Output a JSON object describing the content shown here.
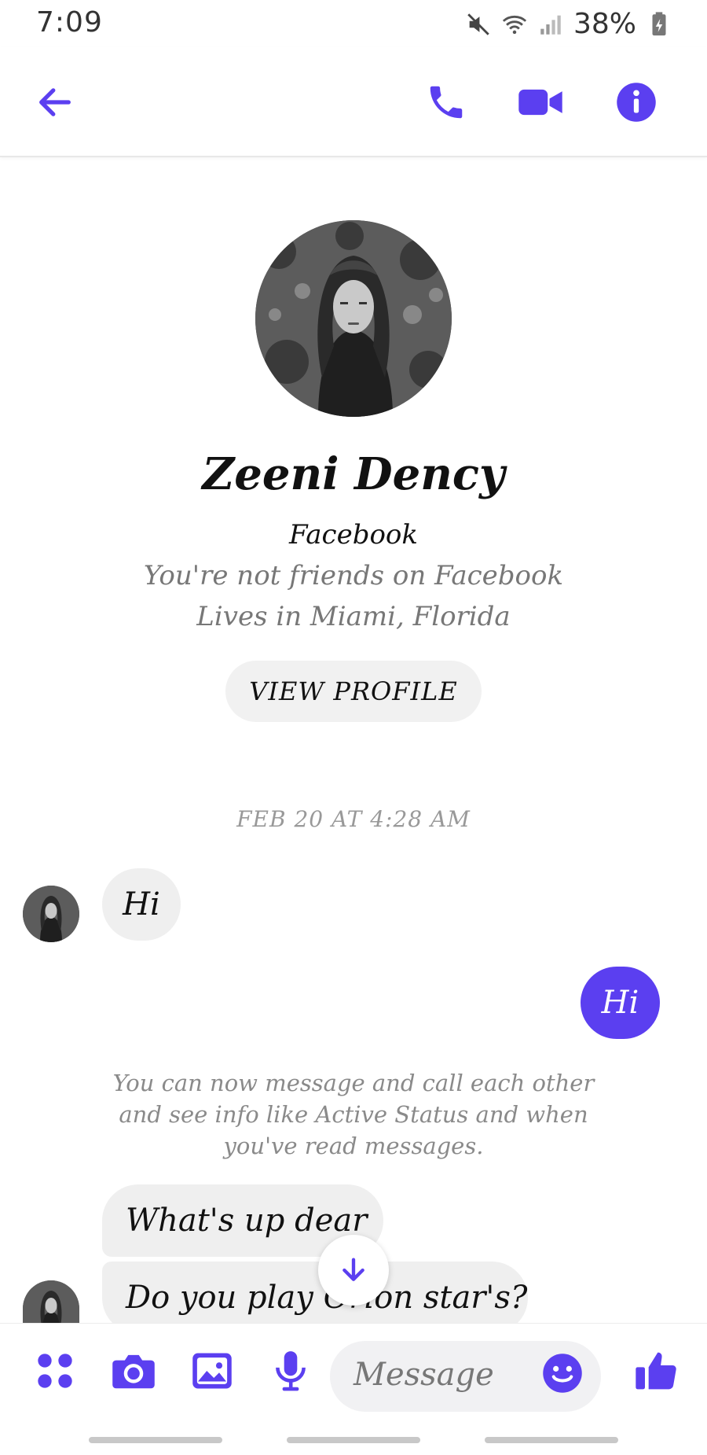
{
  "status_bar": {
    "time": "7:09",
    "battery": "38%"
  },
  "header": {
    "back": "back-arrow-icon",
    "call": "phone-icon",
    "video": "video-camera-icon",
    "info": "info-icon"
  },
  "profile": {
    "name": "Zeeni Dency",
    "source": "Facebook",
    "friendship": "You're not friends on Facebook",
    "lives": "Lives in Miami, Florida",
    "view_profile_label": "VIEW PROFILE"
  },
  "conversation": {
    "timestamp": "FEB 20 AT 4:28 AM",
    "messages": [
      {
        "direction": "incoming",
        "text": "Hi"
      },
      {
        "direction": "outgoing",
        "text": "Hi"
      },
      {
        "direction": "incoming",
        "text": "What's up dear"
      },
      {
        "direction": "incoming",
        "text": "Do you play Orion star's?"
      }
    ],
    "notice": "You can now message and call each other and see info like Active Status and when you've read messages."
  },
  "composer": {
    "placeholder": "Message",
    "icons": [
      "apps-icon",
      "camera-icon",
      "gallery-icon",
      "microphone-icon",
      "emoji-icon",
      "thumbs-up-icon"
    ]
  },
  "colors": {
    "accent": "#5b3ff0",
    "incoming_bubble": "#efefef"
  }
}
